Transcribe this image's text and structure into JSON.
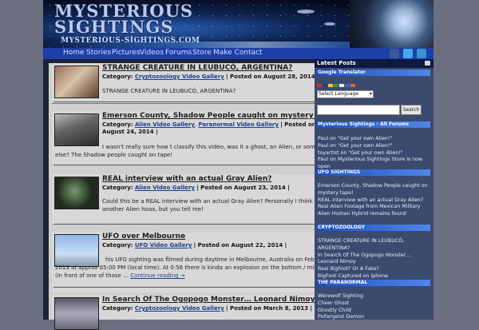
{
  "site": {
    "logo_line1": "MYSTERIOUS",
    "logo_line2": "SIGHTINGS",
    "logo_url": "MYSTERIOUS-SIGHTINGS.COM"
  },
  "nav": {
    "items": [
      "Home",
      "Stories",
      "Pictures",
      "Videos",
      "Forums",
      "Store",
      "Make Contact"
    ],
    "social": [
      "facebook-icon",
      "twitter-icon",
      "youtube-icon"
    ]
  },
  "posts": [
    {
      "title": "STRANGE CREATURE IN LEUBUCÓ, ARGENTINA?",
      "category_label": "Category:",
      "categories": [
        "Cryptozoology Video Gallery"
      ],
      "posted": "| Posted on August 28, 2014 |",
      "excerpt": "STRANGE CREATURE IN LEUBUCÓ, ARGENTINA?"
    },
    {
      "title": "Emerson County, Shadow People caught on mystery tape!",
      "category_label": "Category:",
      "categories": [
        "Alien Video Gallery",
        "Paranormal Video Gallery"
      ],
      "posted": "| Posted on",
      "posted_date": "August 24, 2014 |",
      "excerpt": "I wasn't really sure how t classify this video, was it a ghost, an Alien, or something else? The Shadow people caught on tape!"
    },
    {
      "title": "REAL interview with an actual Gray Alien?",
      "category_label": "Category:",
      "categories": [
        "Alien Video Gallery"
      ],
      "posted": "| Posted on August 23, 2014 |",
      "excerpt": "Could this be a REAL interview with an actual Gray Alien? Personally I think its another Alien hoax, but you tell me!"
    },
    {
      "title": "UFO over Melbourne",
      "category_label": "Category:",
      "categories": [
        "UFO Video Gallery"
      ],
      "posted": "| Posted on August 22, 2014 |",
      "excerpt": "his UFO sighting was filmed during daytime in Melbourne, Australia on February 9, 2013 at approx 05:00 PM (local time). At 0:56 there is kinda an explosion on the bottom / middle area (in front of one of those …",
      "more": "Continue reading →"
    },
    {
      "title": "In Search Of The Ogopogo Monster… Leonard Nimoy",
      "category_label": "Category:",
      "categories": [
        "Cryptozoology Video Gallery"
      ],
      "posted": "| Posted on March 8, 2013 |"
    }
  ],
  "sidebar": {
    "latest_posts_header": "Latest Posts",
    "translator_bar": "Google Translator",
    "select_language": "Select Language",
    "search_button": "Search",
    "forums_bar": "Mysterious Sightings - All Forums",
    "forum_items": [
      "Paul on \"Get your own Alien!\"",
      "Paul on \"Get your own Alien!\"",
      "toyartist on \"Get your own Alien!\"",
      "Paul on Mysterious Sightings Store is now open"
    ],
    "ufo_bar": "UFO SIGHTINGS",
    "ufo_items": [
      "Emerson County, Shadow People caught on mystery tape!",
      "REAL interview with an actual Gray Alien?",
      "Real Alien Footage from Mexican Military",
      "Alien Human Hybrid remains found"
    ],
    "crypto_bar": "CRYPTOZOOLOGY",
    "crypto_items": [
      "STRANGE CREATURE IN LEUBUCÓ, ARGENTINA?",
      "In Search Of The Ogopogo Monster… Leonard Nimoy",
      "Real Bigfoot? Or A Fake?",
      "BigFoot Captured on iphone"
    ],
    "paranormal_bar": "THE PARANORMAL",
    "paranormal_items": [
      "Werewolf Sighting",
      "Cheer Ghost",
      "Ghostly Child",
      "Poltergeist Demon"
    ]
  },
  "colors": {
    "nav_bg": "#1e3fa8",
    "sidebar_bg": "#3b4a6f",
    "link": "#1d3f8a"
  }
}
